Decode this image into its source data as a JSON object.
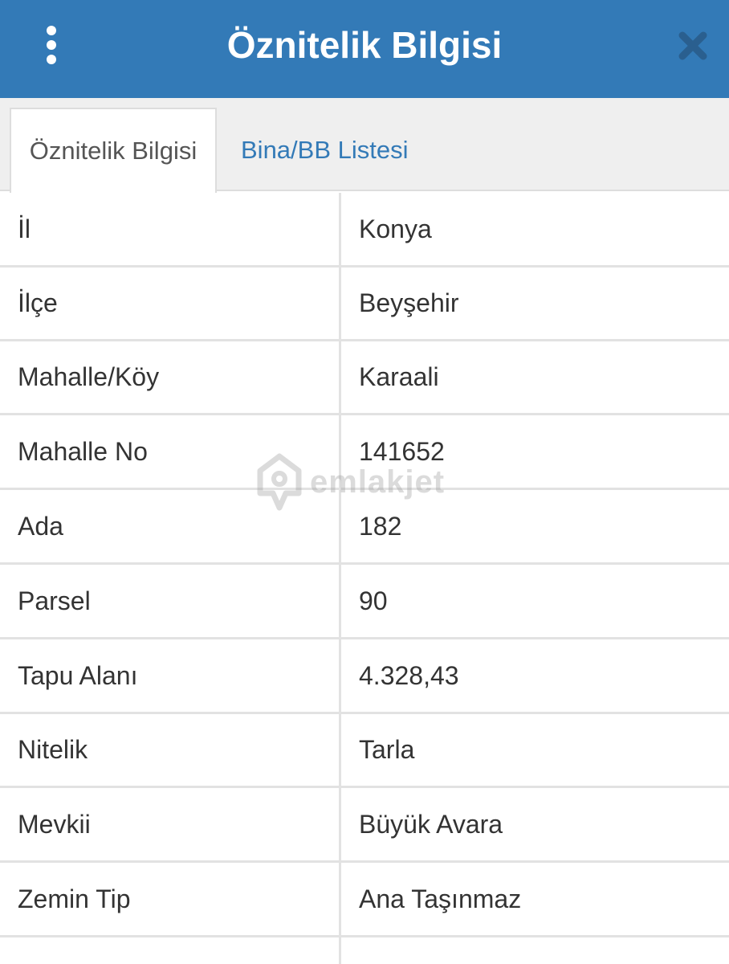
{
  "header": {
    "title": "Öznitelik Bilgisi",
    "menu_icon": "more-vertical-icon",
    "close_icon": "close-icon",
    "color": "#337ab7"
  },
  "tabs": [
    {
      "label": "Öznitelik Bilgisi",
      "active": true
    },
    {
      "label": "Bina/BB Listesi",
      "active": false,
      "color": "#337ab7"
    }
  ],
  "rows": [
    {
      "key": "İl",
      "value": "Konya"
    },
    {
      "key": "İlçe",
      "value": "Beyşehir"
    },
    {
      "key": "Mahalle/Köy",
      "value": "Karaali"
    },
    {
      "key": "Mahalle No",
      "value": "141652"
    },
    {
      "key": "Ada",
      "value": "182"
    },
    {
      "key": "Parsel",
      "value": "90"
    },
    {
      "key": "Tapu Alanı",
      "value": "4.328,43"
    },
    {
      "key": "Nitelik",
      "value": "Tarla"
    },
    {
      "key": "Mevkii",
      "value": "Büyük Avara"
    },
    {
      "key": "Zemin Tip",
      "value": "Ana Taşınmaz"
    }
  ],
  "watermark": {
    "text": "emlakjet",
    "icon": "home-pin-logo-icon"
  }
}
